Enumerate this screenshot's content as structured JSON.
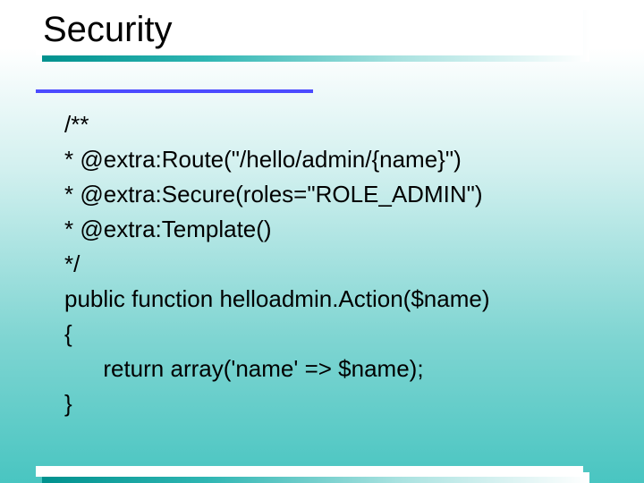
{
  "title": "Security",
  "code": {
    "l1": "/**",
    "l2": "* @extra:Route(\"/hello/admin/{name}\")",
    "l3": "* @extra:Secure(roles=\"ROLE_ADMIN\")",
    "l4": "* @extra:Template()",
    "l5": "*/",
    "l6": "public function helloadmin.Action($name)",
    "l7": "{",
    "l8": "      return array('name' => $name);",
    "l9": "}"
  }
}
